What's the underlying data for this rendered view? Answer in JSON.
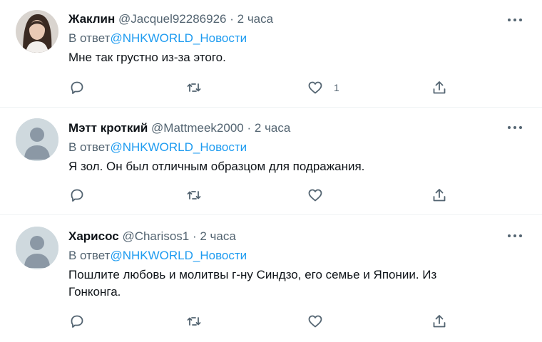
{
  "tweets": [
    {
      "name": "Жаклин",
      "handle": "@Jacquel92286926",
      "dot": "·",
      "time": "2 часа",
      "reply_prefix": "В ответ",
      "reply_to": "@NHKWORLD_Новости",
      "text": "Мне так грустно из-за этого.",
      "like_count": "1"
    },
    {
      "name": "Мэтт кроткий",
      "handle": "@Mattmeek2000",
      "dot": "·",
      "time": "2 часа",
      "reply_prefix": "В ответ",
      "reply_to": "@NHKWORLD_Новости",
      "text": "Я зол. Он был отличным образцом для подражания."
    },
    {
      "name": "Харисос",
      "handle": "@Charisos1",
      "dot": "·",
      "time": "2 часа",
      "reply_prefix": "В ответ",
      "reply_to": "@NHKWORLD_Новости",
      "text": "Пошлите любовь и молитвы г-ну Синдзо, его семье и Японии. Из Гонконга."
    }
  ],
  "icons": {
    "reply": "comment-icon",
    "retweet": "retweet-icon",
    "like": "heart-icon",
    "share": "share-icon",
    "more": "more-icon"
  },
  "colors": {
    "link": "#1d9bf0",
    "secondary": "#536471",
    "divider": "#eff3f4"
  }
}
